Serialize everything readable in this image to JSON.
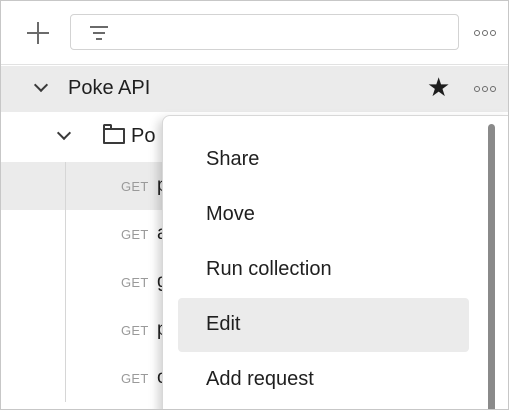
{
  "toolbar": {
    "add_icon": "plus-icon",
    "filter_icon": "filter-icon",
    "more_icon": "more-dots-icon"
  },
  "collection": {
    "name": "Poke API",
    "star_icon": "star-icon"
  },
  "folder": {
    "name_visible": "Po"
  },
  "requests": [
    {
      "method": "GET",
      "name_visible": "p",
      "selected": true
    },
    {
      "method": "GET",
      "name_visible": "a",
      "selected": false
    },
    {
      "method": "GET",
      "name_visible": "g",
      "selected": false
    },
    {
      "method": "GET",
      "name_visible": "p",
      "selected": false
    },
    {
      "method": "GET",
      "name_visible": "o",
      "selected": false
    }
  ],
  "context_menu": {
    "items": [
      {
        "label": "Share"
      },
      {
        "label": "Move"
      },
      {
        "label": "Run collection"
      },
      {
        "label": "Edit"
      },
      {
        "label": "Add request"
      }
    ],
    "hovered_index": 3
  },
  "colors": {
    "selected_row_bg": "#ebebeb",
    "menu_hover_bg": "#ebebeb",
    "method_text": "#9a9a9a"
  }
}
